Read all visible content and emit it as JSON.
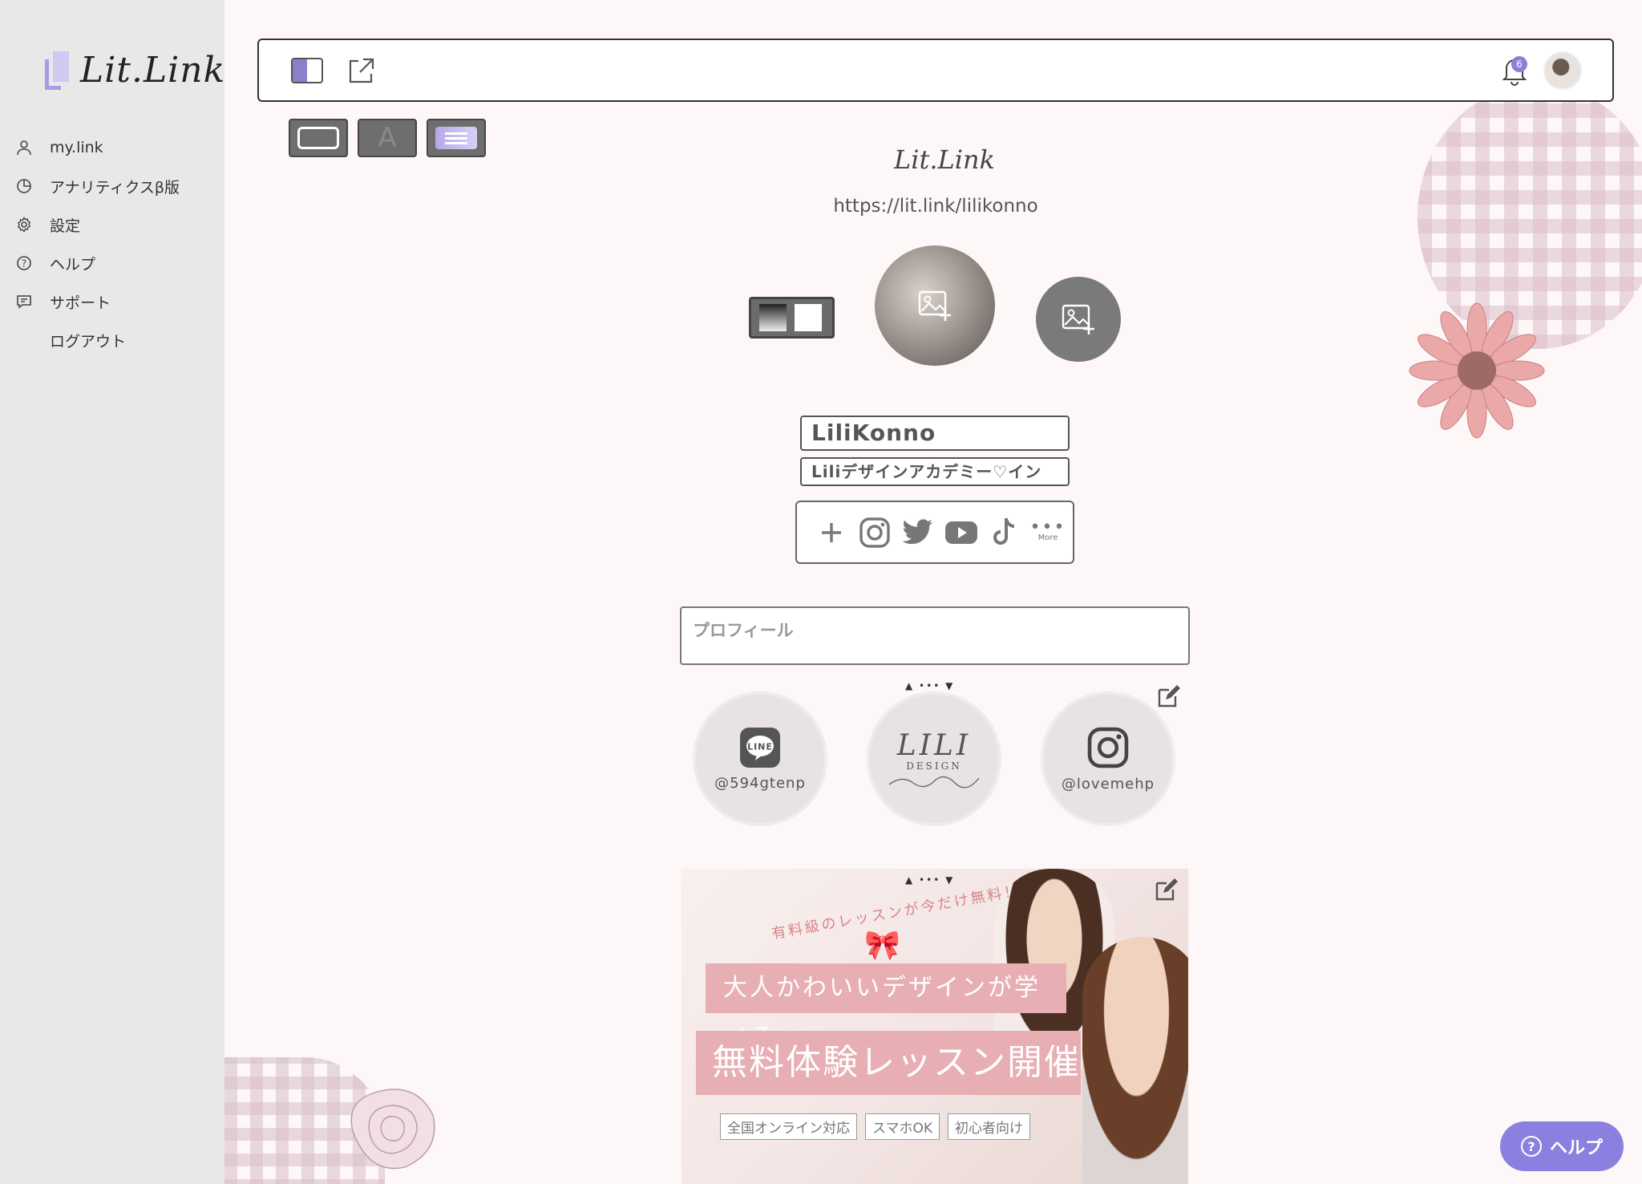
{
  "sidebar": {
    "logo_text": "Lit.Link",
    "items": [
      {
        "label": "my.link",
        "icon": "user-icon"
      },
      {
        "label": "アナリティクスβ版",
        "icon": "analytics-icon"
      },
      {
        "label": "設定",
        "icon": "gear-icon"
      },
      {
        "label": "ヘルプ",
        "icon": "help-icon"
      },
      {
        "label": "サポート",
        "icon": "support-icon"
      },
      {
        "label": "ログアウト",
        "icon": ""
      }
    ]
  },
  "topbar": {
    "notification_count": "6"
  },
  "preview": {
    "brand": "Lit.Link",
    "url": "https://lit.link/lilikonno",
    "name": "LiliKonno",
    "subtitle": "Liliデザインアカデミー♡イン",
    "more_label": "More",
    "profile_placeholder": "プロフィール",
    "links": [
      {
        "label": "@594gtenp",
        "icon": "line-icon"
      },
      {
        "label": "",
        "icon": "lili-design-logo",
        "logo_text": "LILI",
        "logo_sub": "DESIGN"
      },
      {
        "label": "@lovemehp",
        "icon": "instagram-icon"
      }
    ],
    "banner": {
      "arc_text": "有料級のレッスンが今だけ無料！",
      "line1": "大人かわいいデザインが学べる",
      "line2": "無料体験レッスン開催",
      "tags": [
        "全国オンライン対応",
        "スマホOK",
        "初心者向け"
      ]
    }
  },
  "help_button": {
    "label": "ヘルプ"
  },
  "colors": {
    "accent": "#8b80e0",
    "sidebar_bg": "#e8e8e8",
    "page_bg": "#fdf7f8"
  }
}
